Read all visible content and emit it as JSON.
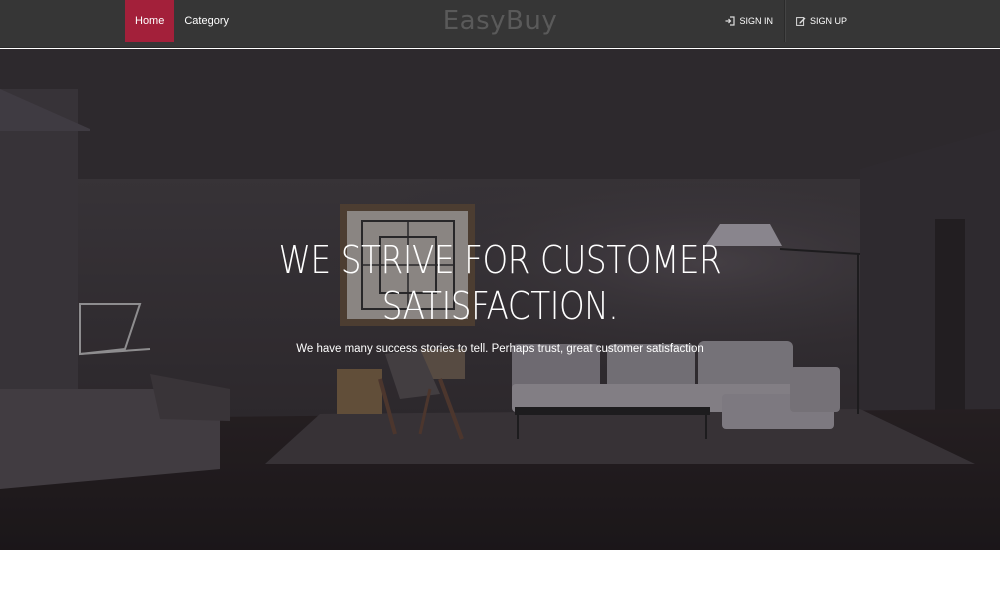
{
  "nav": {
    "items": [
      {
        "label": "Home",
        "active": true
      },
      {
        "label": "Category",
        "active": false
      }
    ],
    "brand": "EasyBuy",
    "auth": {
      "sign_in": {
        "label": "SIGN IN",
        "icon": "sign-in-icon"
      },
      "sign_up": {
        "label": "SIGN UP",
        "icon": "edit-icon"
      }
    }
  },
  "hero": {
    "title_line1": "WE STRIVE FOR CUSTOMER",
    "title_line2": "SATISFACTION.",
    "subtitle": "We have many success stories to tell. Perhaps trust, great customer satisfaction"
  },
  "colors": {
    "navbar_bg": "#363636",
    "active_tab": "#a3203a",
    "brand_text": "#5a5a5a",
    "hero_overlay": "#2f2c30"
  }
}
